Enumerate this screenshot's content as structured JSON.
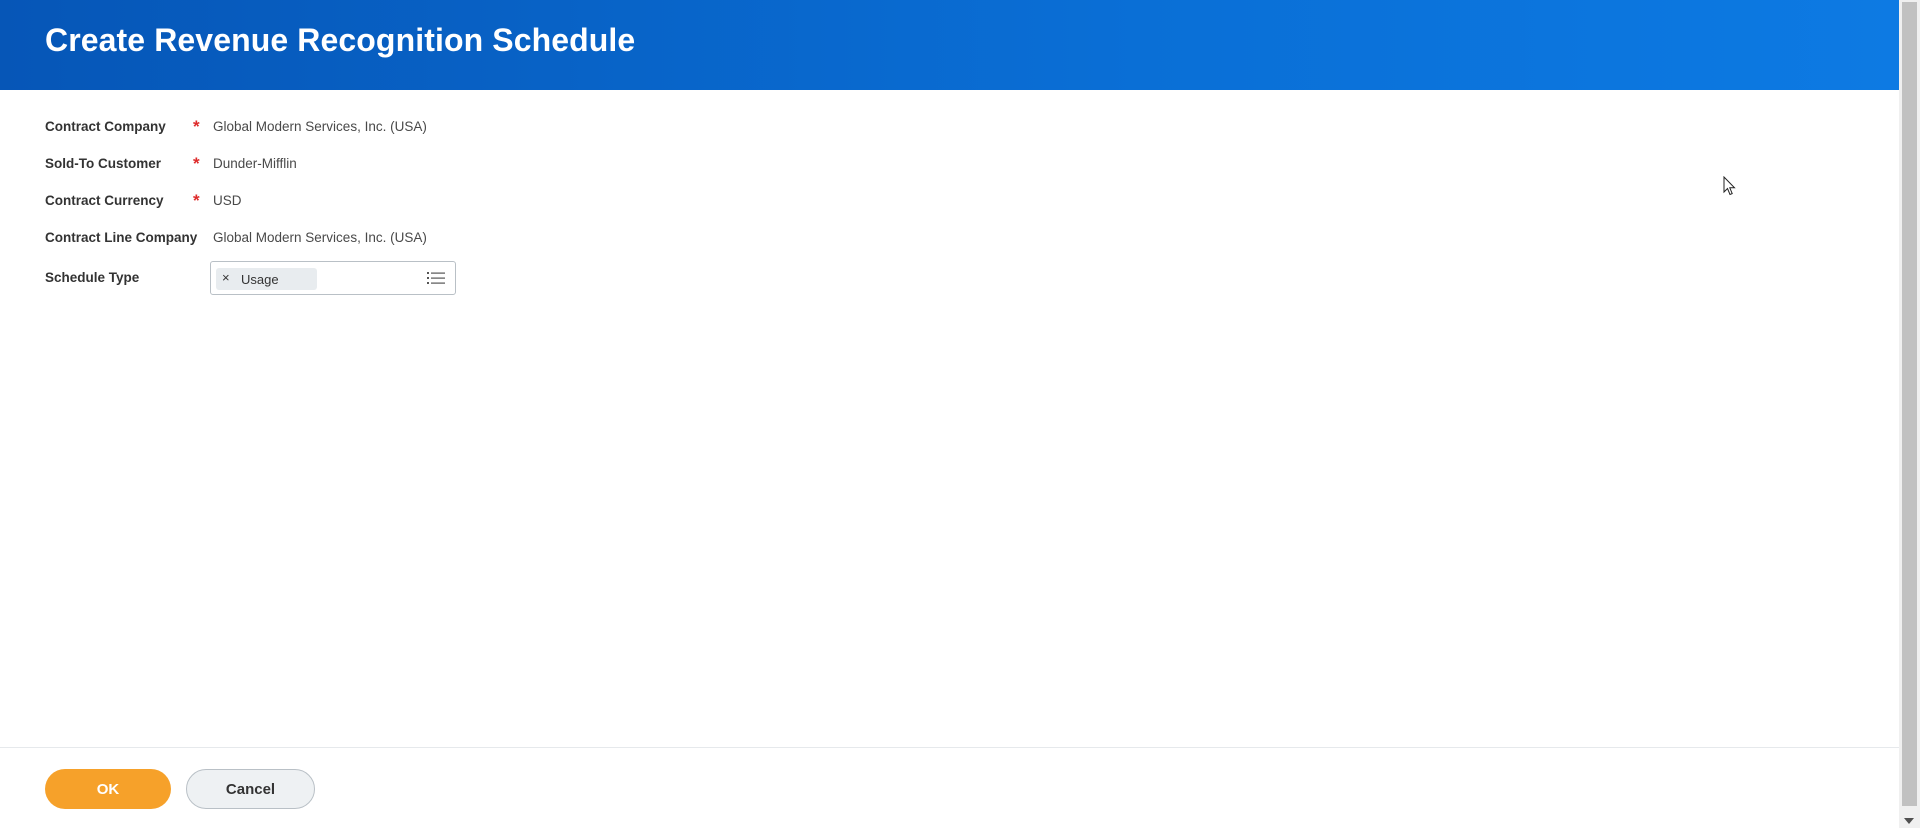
{
  "header": {
    "title": "Create Revenue Recognition Schedule"
  },
  "fields": [
    {
      "label": "Contract Company",
      "required": "*",
      "value": "Global Modern Services, Inc. (USA)"
    },
    {
      "label": "Sold-To Customer",
      "required": "*",
      "value": "Dunder-Mifflin"
    },
    {
      "label": "Contract Currency",
      "required": "*",
      "value": "USD"
    },
    {
      "label": "Contract Line Company",
      "required": "",
      "value": "Global Modern Services, Inc. (USA)"
    }
  ],
  "schedule_type": {
    "label": "Schedule Type",
    "selected": "Usage",
    "remove_glyph": "×",
    "icon": "list-icon"
  },
  "footer": {
    "ok_label": "OK",
    "cancel_label": "Cancel"
  },
  "colors": {
    "header": "#0a6fd6",
    "ok_button": "#f6a12a",
    "required": "#de2a2a"
  }
}
